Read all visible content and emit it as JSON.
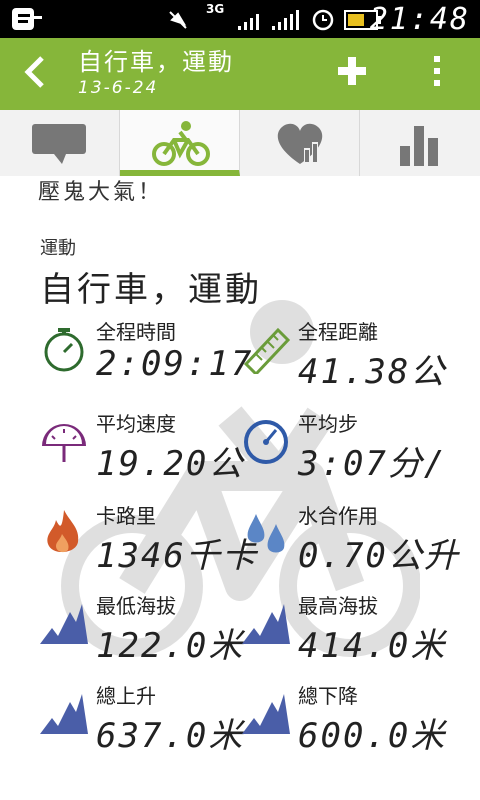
{
  "status_bar": {
    "network": "3G",
    "clock": "21:48"
  },
  "action_bar": {
    "title": "自行車，運動",
    "subtitle": "13-6-24"
  },
  "content": {
    "overflow_text": "壓鬼大氣！",
    "section_label": "運動",
    "section_title": "自行車，運動",
    "stats": [
      {
        "label": "全程時間",
        "value": "2:09:17"
      },
      {
        "label": "全程距離",
        "value": "41.38公"
      },
      {
        "label": "平均速度",
        "value": "19.20公"
      },
      {
        "label": "平均步",
        "value": "3:07分/"
      },
      {
        "label": "卡路里",
        "value": "1346千卡"
      },
      {
        "label": "水合作用",
        "value": "0.70公升"
      },
      {
        "label": "最低海拔",
        "value": "122.0米"
      },
      {
        "label": "最高海拔",
        "value": "414.0米"
      },
      {
        "label": "總上升",
        "value": "637.0米"
      },
      {
        "label": "總下降",
        "value": "600.0米"
      }
    ]
  },
  "colors": {
    "accent": "#86b63a",
    "stopwatch": "#2e6b2e",
    "ruler": "#6a9c3a",
    "gauge_purple": "#7a2a7a",
    "gauge_blue": "#2f5aa8",
    "flame": "#d25a2a",
    "drops": "#5b86c6",
    "mountain": "#4a5ea8"
  }
}
